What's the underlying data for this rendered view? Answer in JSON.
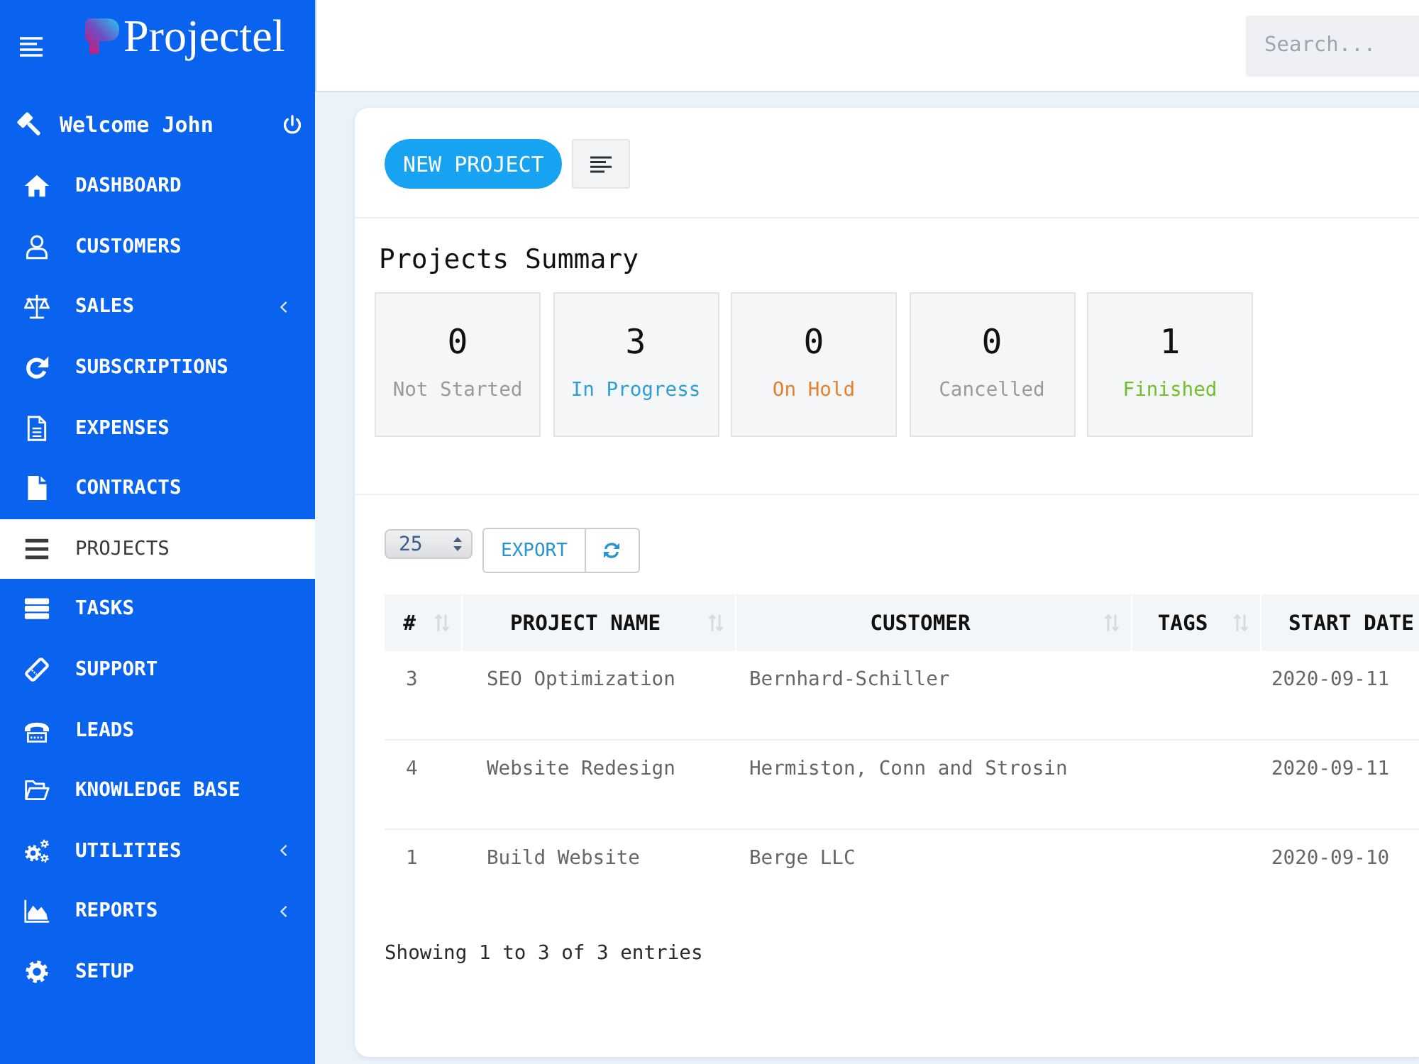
{
  "sidebar": {
    "logo": "Projectel",
    "welcome": "Welcome John",
    "items": [
      {
        "label": "DASHBOARD",
        "selected": false,
        "has_submenu": false
      },
      {
        "label": "CUSTOMERS",
        "selected": false,
        "has_submenu": false
      },
      {
        "label": "SALES",
        "selected": false,
        "has_submenu": true
      },
      {
        "label": "SUBSCRIPTIONS",
        "selected": false,
        "has_submenu": false
      },
      {
        "label": "EXPENSES",
        "selected": false,
        "has_submenu": false
      },
      {
        "label": "CONTRACTS",
        "selected": false,
        "has_submenu": false
      },
      {
        "label": "PROJECTS",
        "selected": true,
        "has_submenu": false
      },
      {
        "label": "TASKS",
        "selected": false,
        "has_submenu": false
      },
      {
        "label": "SUPPORT",
        "selected": false,
        "has_submenu": false
      },
      {
        "label": "LEADS",
        "selected": false,
        "has_submenu": false
      },
      {
        "label": "KNOWLEDGE BASE",
        "selected": false,
        "has_submenu": false
      },
      {
        "label": "UTILITIES",
        "selected": false,
        "has_submenu": true
      },
      {
        "label": "REPORTS",
        "selected": false,
        "has_submenu": true
      },
      {
        "label": "SETUP",
        "selected": false,
        "has_submenu": false
      }
    ]
  },
  "search": {
    "placeholder": "Search..."
  },
  "toolbar": {
    "new_button": "NEW PROJECT"
  },
  "summary": {
    "title": "Projects Summary",
    "stats": [
      {
        "count": "0",
        "label": "Not Started",
        "color": "#9a9a9a"
      },
      {
        "count": "3",
        "label": "In Progress",
        "color": "#2d9fd3"
      },
      {
        "count": "0",
        "label": "On Hold",
        "color": "#e5802f"
      },
      {
        "count": "0",
        "label": "Cancelled",
        "color": "#9a9a9a"
      },
      {
        "count": "1",
        "label": "Finished",
        "color": "#74be2e"
      }
    ]
  },
  "table_controls": {
    "page_size": "25",
    "export_button": "EXPORT"
  },
  "table": {
    "columns": [
      {
        "label": "#",
        "sortable": true
      },
      {
        "label": "PROJECT NAME",
        "sortable": true
      },
      {
        "label": "CUSTOMER",
        "sortable": true
      },
      {
        "label": "TAGS",
        "sortable": true
      },
      {
        "label": "START DATE",
        "sortable": false
      }
    ],
    "rows": [
      {
        "number": "3",
        "project_name": "SEO Optimization",
        "customer": "Bernhard-Schiller",
        "start_date": "2020-09-11"
      },
      {
        "number": "4",
        "project_name": "Website Redesign",
        "customer": "Hermiston, Conn and Strosin",
        "start_date": "2020-09-11"
      },
      {
        "number": "1",
        "project_name": "Build Website",
        "customer": "Berge LLC",
        "start_date": "2020-09-10"
      }
    ]
  },
  "footer": "Showing 1 to 3 of 3 entries"
}
